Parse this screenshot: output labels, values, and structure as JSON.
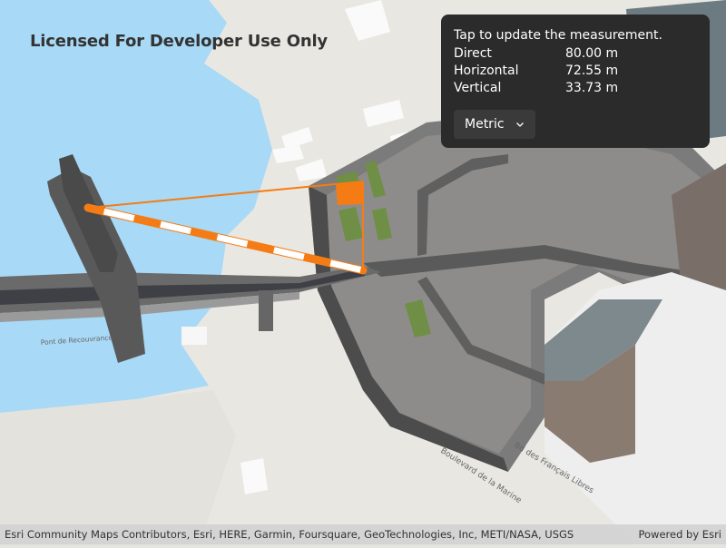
{
  "license_text": "Licensed For Developer Use Only",
  "measurement": {
    "hint": "Tap to update the measurement.",
    "rows": [
      {
        "label": "Direct",
        "value": "80.00 m"
      },
      {
        "label": "Horizontal",
        "value": "72.55 m"
      },
      {
        "label": "Vertical",
        "value": "33.73 m"
      }
    ],
    "unit_system": "Metric"
  },
  "map_labels": {
    "bridge": "Pont de Recouvrance",
    "boulevard": "Boulevard de la Marine",
    "francais": "Bd des Français Libres"
  },
  "attribution": {
    "credits": "Esri Community Maps Contributors, Esri, HERE, Garmin, Foursquare, GeoTechnologies, Inc, METI/NASA, USGS",
    "powered": "Powered by Esri"
  },
  "colors": {
    "water": "#a6d8f5",
    "measure_line": "#f57c14",
    "panel_bg": "#2b2b2b"
  },
  "icons": {
    "dropdown": "chevron-down-icon"
  }
}
